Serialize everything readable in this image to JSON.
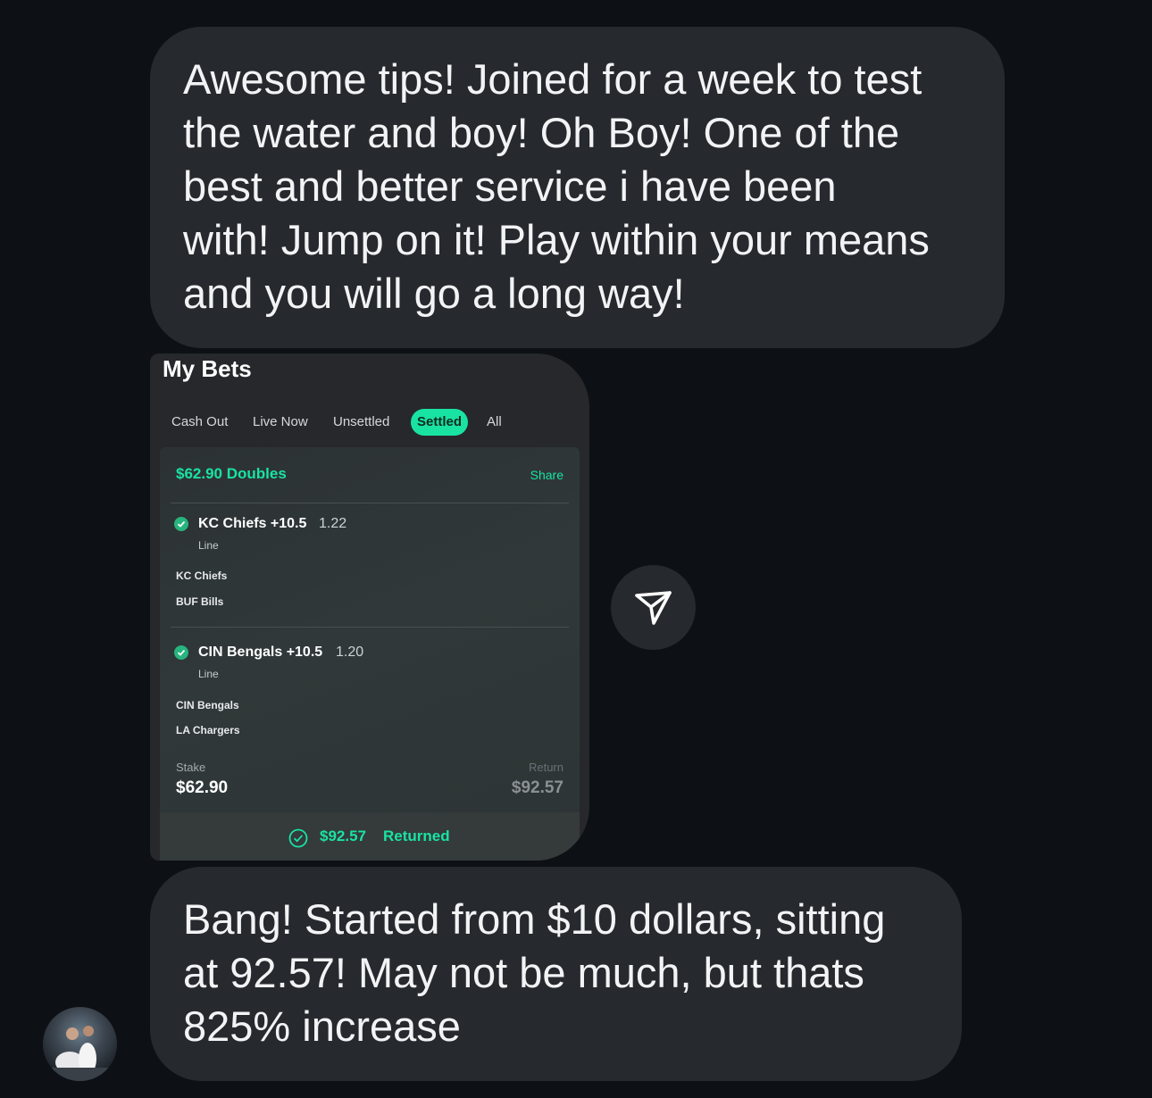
{
  "messages": {
    "first": "Awesome tips! Joined for a week to test\nthe water and boy! Oh Boy! One of the\nbest and better service i have been\nwith! Jump on it! Play within your means\nand you will go a long way!",
    "second": "Bang! Started from $10 dollars, sitting\nat 92.57! May not be much, but thats\n825% increase"
  },
  "bet_screenshot": {
    "title": "My Bets",
    "tabs": [
      {
        "label": "Cash Out",
        "active": false
      },
      {
        "label": "Live Now",
        "active": false
      },
      {
        "label": "Unsettled",
        "active": false
      },
      {
        "label": "Settled",
        "active": true
      },
      {
        "label": "All",
        "active": false
      }
    ],
    "bet_title": "$62.90 Doubles",
    "share_label": "Share",
    "legs": [
      {
        "selection": "KC Chiefs +10.5",
        "odds": "1.22",
        "market": "Line",
        "teams": [
          "KC Chiefs",
          "BUF Bills"
        ],
        "status_icon": "check-circle-icon"
      },
      {
        "selection": "CIN Bengals +10.5",
        "odds": "1.20",
        "market": "Line",
        "teams": [
          "CIN Bengals",
          "LA Chargers"
        ],
        "status_icon": "check-circle-icon"
      }
    ],
    "stake_label": "Stake",
    "stake_value": "$62.90",
    "return_label": "Return",
    "return_value": "$92.57",
    "returned_amount": "$92.57",
    "returned_label": "Returned"
  },
  "share_button_icon": "send-icon",
  "avatar_icon": "user-avatar",
  "colors": {
    "background": "#0d1116",
    "bubble": "#26292d",
    "accent_green": "#19e3a1",
    "text": "#f2f3f5"
  }
}
